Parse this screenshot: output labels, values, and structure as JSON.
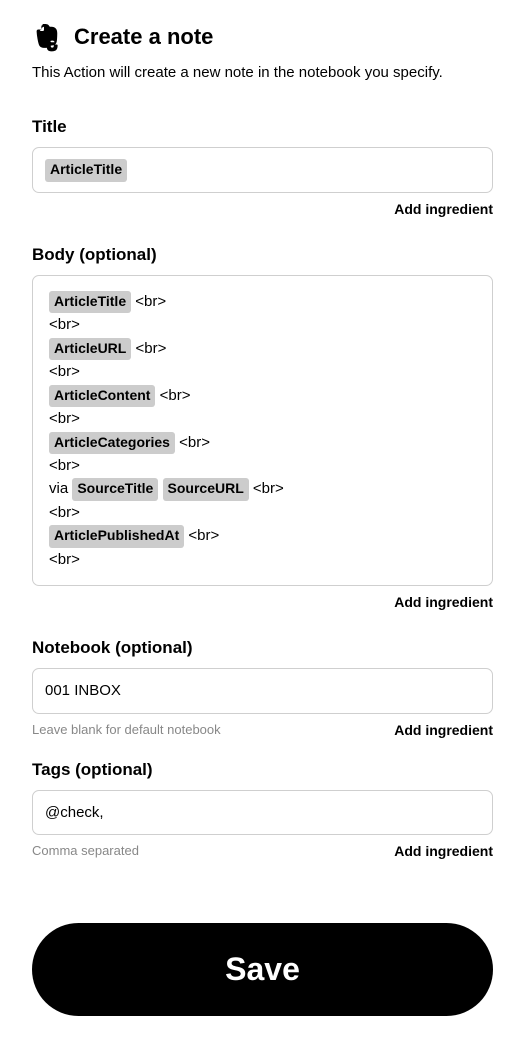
{
  "header": {
    "title": "Create a note",
    "icon": "evernote-icon"
  },
  "description": "This Action will create a new note in the notebook you specify.",
  "fields": {
    "title": {
      "label": "Title",
      "chips": [
        "ArticleTitle"
      ],
      "add_link": "Add ingredient"
    },
    "body": {
      "label": "Body (optional)",
      "lines": [
        {
          "chips": [
            "ArticleTitle"
          ],
          "trailing": " <br>"
        },
        {
          "text": "<br>"
        },
        {
          "chips": [
            "ArticleURL"
          ],
          "trailing": " <br>"
        },
        {
          "text": "<br>"
        },
        {
          "chips": [
            "ArticleContent"
          ],
          "trailing": " <br>"
        },
        {
          "text": "<br>"
        },
        {
          "chips": [
            "ArticleCategories"
          ],
          "trailing": " <br>"
        },
        {
          "text": "<br>"
        },
        {
          "leading": "via ",
          "chips": [
            "SourceTitle",
            "SourceURL"
          ],
          "trailing": " <br>"
        },
        {
          "text": "<br>"
        },
        {
          "chips": [
            "ArticlePublishedAt"
          ],
          "trailing": " <br>"
        },
        {
          "text": "<br>"
        }
      ],
      "add_link": "Add ingredient"
    },
    "notebook": {
      "label": "Notebook (optional)",
      "value": "001 INBOX",
      "hint": "Leave blank for default notebook",
      "add_link": "Add ingredient"
    },
    "tags": {
      "label": "Tags (optional)",
      "value": "@check,",
      "hint": "Comma separated",
      "add_link": "Add ingredient"
    }
  },
  "save_label": "Save"
}
